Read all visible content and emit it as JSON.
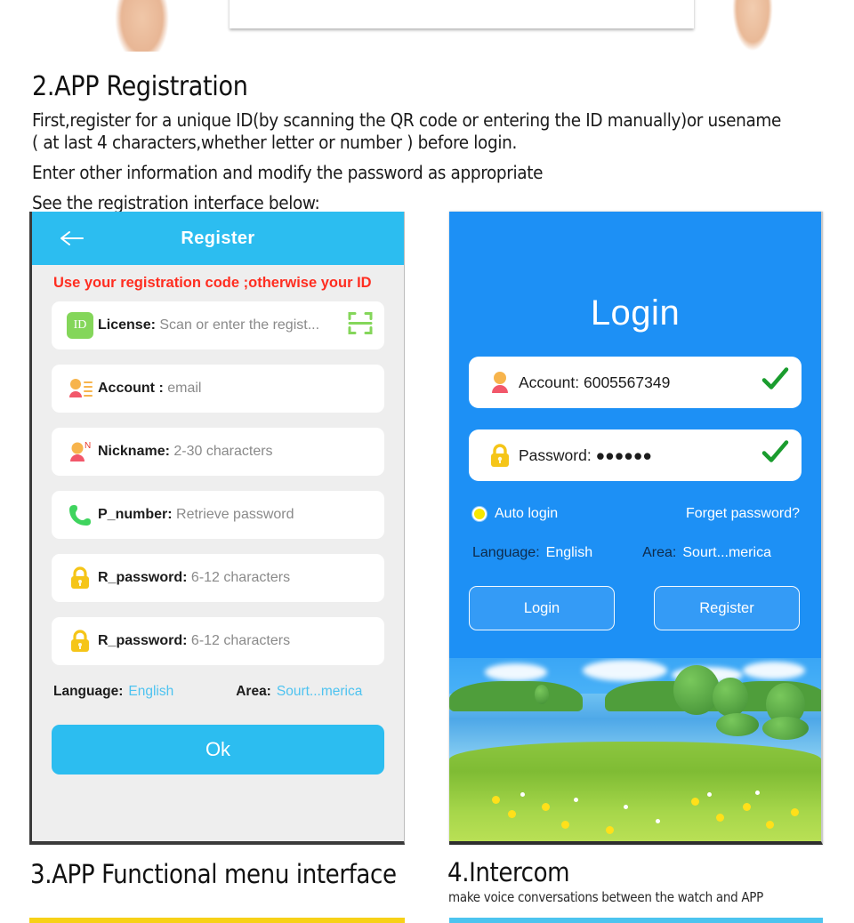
{
  "document": {
    "section2": {
      "heading": "2.APP Registration",
      "line1": "First,register for a unique ID(by scanning the QR code or entering the ID manually)or usename",
      "line2": "( at last 4 characters,whether letter or number ) before login.",
      "line3": "Enter other information and modify the password as appropriate",
      "line4": "See the registration interface below:"
    },
    "section3": {
      "heading": "3.APP Functional menu interface"
    },
    "section4": {
      "heading": "4.Intercom",
      "subtitle": "make voice conversations between the watch and APP"
    }
  },
  "register_screen": {
    "back_icon": "arrow-left-icon",
    "title": "Register",
    "warning": "Use your registration code ;otherwise your ID",
    "fields": [
      {
        "icon": "id-badge-icon",
        "icon_text": "ID",
        "label": "License:",
        "placeholder": "Scan or enter the regist...",
        "trailing_icon": "qr-scan-icon"
      },
      {
        "icon": "account-list-icon",
        "label": "Account :",
        "placeholder": "email",
        "trailing_icon": ""
      },
      {
        "icon": "nickname-icon",
        "label": "Nickname:",
        "placeholder": "2-30 characters",
        "trailing_icon": ""
      },
      {
        "icon": "phone-icon",
        "label": "P_number:",
        "placeholder": "Retrieve password",
        "trailing_icon": ""
      },
      {
        "icon": "lock-icon",
        "label": "R_password:",
        "placeholder": "6-12 characters",
        "trailing_icon": ""
      },
      {
        "icon": "lock-icon",
        "label": "R_password:",
        "placeholder": "6-12 characters",
        "trailing_icon": ""
      }
    ],
    "language_label": "Language:",
    "language_value": "English",
    "area_label": "Area:",
    "area_value": "Sourt...merica",
    "ok_button": "Ok",
    "colors": {
      "header": "#2cbdf0",
      "warning_text": "#ff2d20",
      "ok_button": "#2cbdf0",
      "link": "#4ec3f0"
    }
  },
  "login_screen": {
    "title": "Login",
    "fields": [
      {
        "icon": "account-icon",
        "label": "Account:",
        "value": "6005567349",
        "status_icon": "check-icon"
      },
      {
        "icon": "lock-icon",
        "label": "Password:",
        "value": "●●●●●●",
        "status_icon": "check-icon"
      }
    ],
    "auto_login_label": "Auto login",
    "auto_login_checked": true,
    "forget_password": "Forget password?",
    "language_label": "Language:",
    "language_value": "English",
    "area_label": "Area:",
    "area_value": "Sourt...merica",
    "buttons": [
      "Login",
      "Register"
    ],
    "colors": {
      "background": "#1d90f5",
      "radio": "#f6e800",
      "check": "#1a9c2e"
    }
  }
}
